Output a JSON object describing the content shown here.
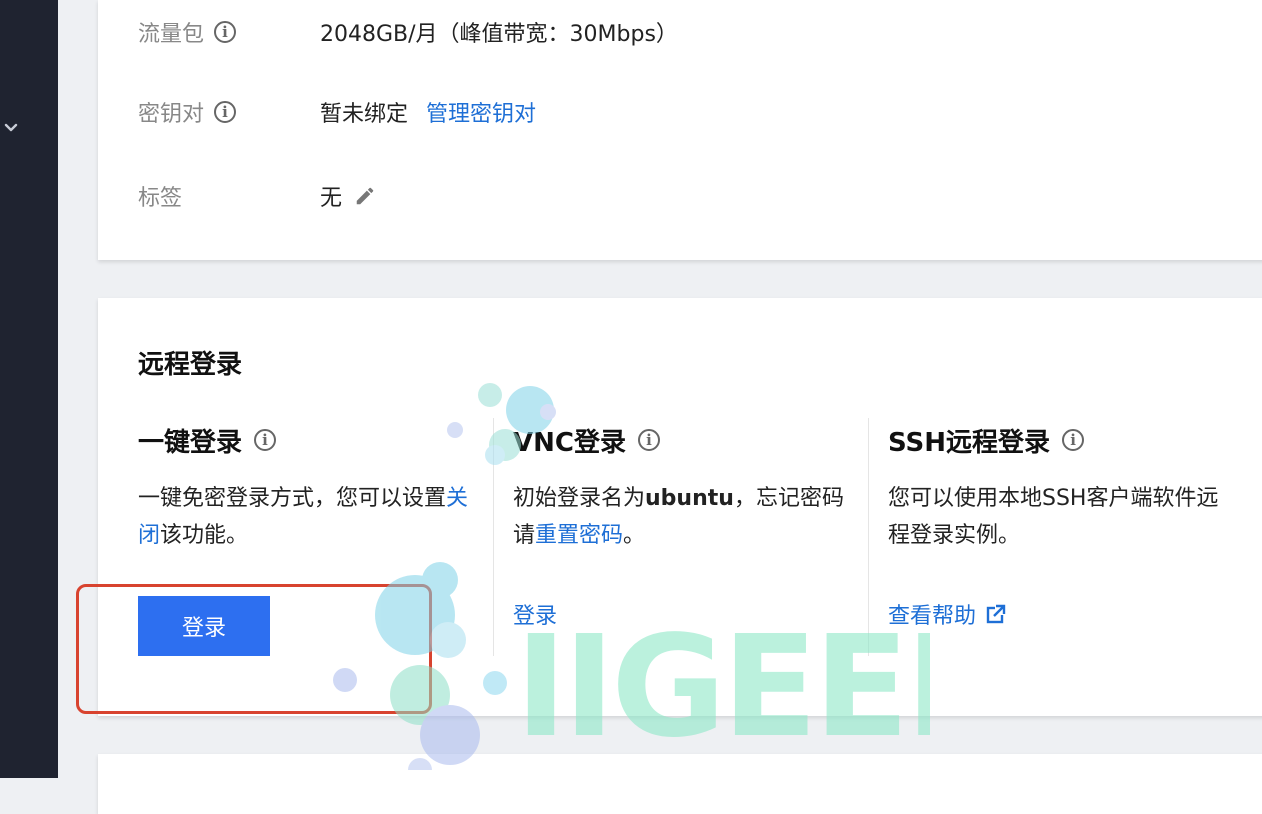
{
  "info": {
    "traffic": {
      "label": "流量包",
      "value": "2048GB/月（峰值带宽：30Mbps）"
    },
    "keypair": {
      "label": "密钥对",
      "value": "暂未绑定",
      "link": "管理密钥对"
    },
    "tags": {
      "label": "标签",
      "value": "无"
    }
  },
  "remote_login": {
    "title": "远程登录",
    "one_click": {
      "title": "一键登录",
      "desc_prefix": "一键免密登录方式，您可以设置",
      "desc_link": "关闭",
      "desc_suffix": "该功能。",
      "button": "登录"
    },
    "vnc": {
      "title": "VNC登录",
      "desc_prefix": "初始登录名为",
      "desc_username": "ubuntu",
      "desc_mid": "，忘记密码请",
      "desc_link": "重置密码",
      "desc_suffix": "。",
      "link": "登录"
    },
    "ssh": {
      "title": "SSH远程登录",
      "desc": "您可以使用本地SSH客户端软件远程登录实例。",
      "link": "查看帮助"
    }
  },
  "icons": {
    "info": "info-circle-icon",
    "edit": "pencil-icon",
    "external": "external-link-icon",
    "sidebar": "chevron-down-icon"
  },
  "colors": {
    "accent": "#2d6ff0",
    "link": "#1e6fd6",
    "highlight": "#d8432f",
    "sidebar": "#1f2330"
  },
  "watermark": {
    "text": "IIGEEK"
  }
}
